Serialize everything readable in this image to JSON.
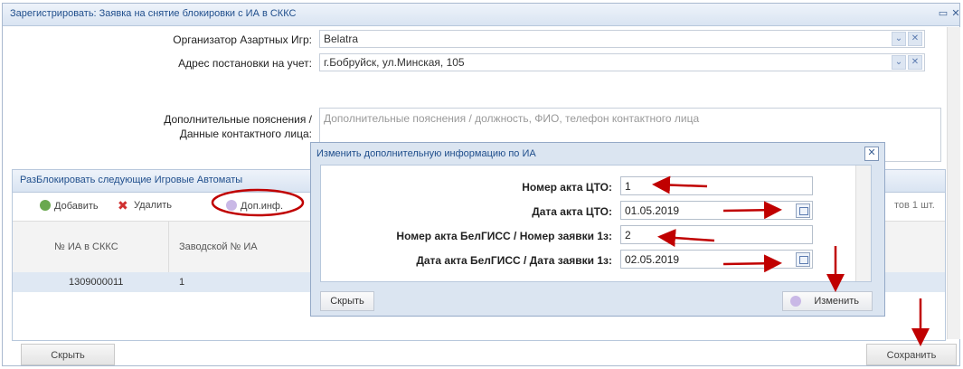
{
  "window": {
    "title": "Зарегистрировать: Заявка на снятие блокировки с ИА в СККС"
  },
  "form": {
    "organizer_label": "Организатор Азартных Игр:",
    "organizer_value": "Belatra",
    "address_label": "Адрес постановки на учет:",
    "address_value": "г.Бобруйск, ул.Минская, 105",
    "notes_label_line1": "Дополнительные пояснения /",
    "notes_label_line2": "Данные контактного лица:",
    "notes_placeholder": "Дополнительные пояснения / должность, ФИО, телефон контактного лица"
  },
  "panel": {
    "title": "РазБлокировать следующие Игровые Автоматы",
    "add_label": "Добавить",
    "delete_label": "Удалить",
    "info_label": "Доп.инф.",
    "count_label": "тов 1 шт.",
    "columns": [
      "№ ИА в СККС",
      "Заводской № ИА"
    ],
    "rows": [
      {
        "ia_number": "1309000011",
        "factory_number": "1"
      }
    ]
  },
  "modal": {
    "title": "Изменить дополнительную информацию по ИА",
    "fields": [
      {
        "label": "Номер акта ЦТО:",
        "value": "1"
      },
      {
        "label": "Дата акта ЦТО:",
        "value": "01.05.2019"
      },
      {
        "label": "Номер акта БелГИСС / Номер заявки 1з:",
        "value": "2"
      },
      {
        "label": "Дата акта БелГИСС / Дата заявки 1з:",
        "value": "02.05.2019"
      }
    ],
    "hide_label": "Скрыть",
    "change_label": "Изменить"
  },
  "footer": {
    "hide_label": "Скрыть",
    "save_label": "Сохранить"
  },
  "colors": {
    "accent": "#1f4e8c",
    "arrow": "#c00000"
  }
}
